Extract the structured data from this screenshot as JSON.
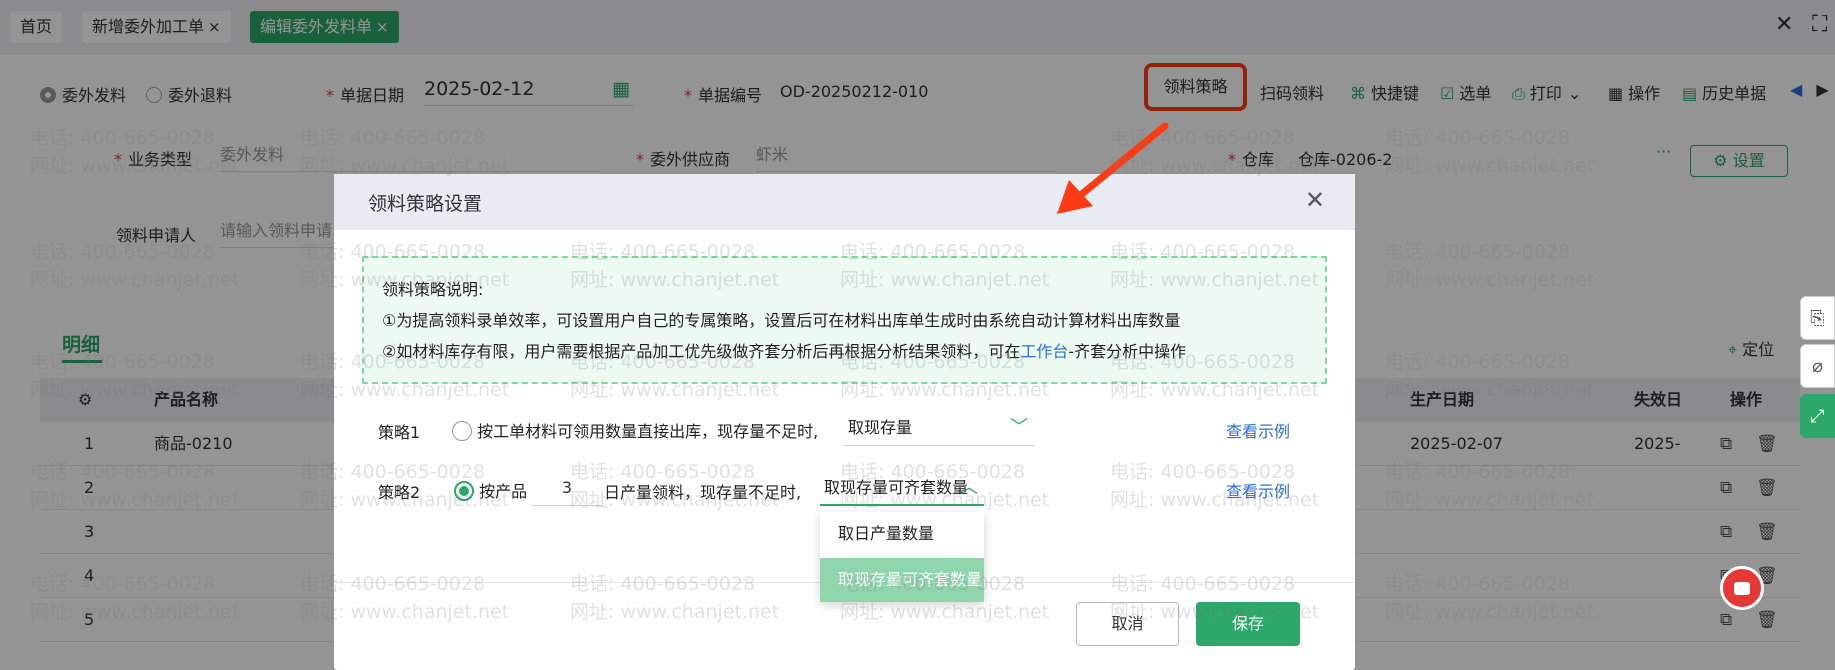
{
  "tabs": [
    {
      "label": "首页"
    },
    {
      "label": "新增委外加工单",
      "close": "×"
    },
    {
      "label": "编辑委外发料单",
      "close": "×"
    }
  ],
  "window": {
    "close": "✕",
    "maximize": "⛶"
  },
  "header": {
    "radio_issue": "委外发料",
    "radio_return": "委外退料",
    "doc_date_label": "单据日期",
    "doc_date_value": "2025-02-12",
    "doc_no_label": "单据编号",
    "doc_no_value": "OD-20250212-010"
  },
  "toolbar": {
    "strategy": "领料策略",
    "scan": "扫码领料",
    "shortcut": "快捷键",
    "select": "选单",
    "print": "打印",
    "operate": "操作",
    "history": "历史单据"
  },
  "form": {
    "biz_type_label": "业务类型",
    "biz_type_value": "委外发料",
    "supplier_label": "委外供应商",
    "supplier_value": "虾米",
    "warehouse_label": "仓库",
    "warehouse_value": "仓库-0206-2",
    "more": "···",
    "settings": "设置",
    "applicant_label": "领料申请人",
    "applicant_placeholder": "请输入领料申请"
  },
  "detail": {
    "tab": "明细",
    "locate": "定位",
    "columns": {
      "product": "产品名称",
      "prod_date": "生产日期",
      "expire": "失效日",
      "action": "操作"
    },
    "rows": [
      {
        "no": "1",
        "product": "商品-0210",
        "prod_date": "2025-02-07",
        "expire": "2025-"
      },
      {
        "no": "2",
        "product": "",
        "prod_date": "",
        "expire": ""
      },
      {
        "no": "3",
        "product": "",
        "prod_date": "",
        "expire": ""
      },
      {
        "no": "4",
        "product": "",
        "prod_date": "",
        "expire": ""
      },
      {
        "no": "5",
        "product": "",
        "prod_date": "",
        "expire": ""
      }
    ]
  },
  "modal": {
    "title": "领料策略设置",
    "notice_title": "领料策略说明:",
    "notice_line1": "①为提高领料录单效率，可设置用户自己的专属策略，设置后可在材料出库单生成时由系统自动计算材料出库数量",
    "notice_line2_pre": "②如材料库存有限，用户需要根据产品加工优先级做齐套分析后再根据分析结果领料，可在",
    "notice_line2_link": "工作台",
    "notice_line2_post": "-齐套分析中操作",
    "strategy1_label": "策略1",
    "strategy1_text": "按工单材料可领用数量直接出库，现存量不足时,",
    "strategy1_select": "取现存量",
    "strategy2_label": "策略2",
    "strategy2_pre": "按产品",
    "strategy2_value": "3",
    "strategy2_post": "日产量领料，现存量不足时,",
    "strategy2_select": "取现存量可齐套数量",
    "view_example": "查看示例",
    "dropdown_options": [
      "取日产量数量",
      "取现存量可齐套数量"
    ],
    "cancel": "取消",
    "save": "保存"
  },
  "watermark": {
    "phone": "电话: 400-665-0028",
    "site": "网址: www.chanjet.net"
  },
  "colors": {
    "accent": "#2ba86a",
    "highlight": "#ff3b14",
    "link": "#2b6fdb"
  }
}
